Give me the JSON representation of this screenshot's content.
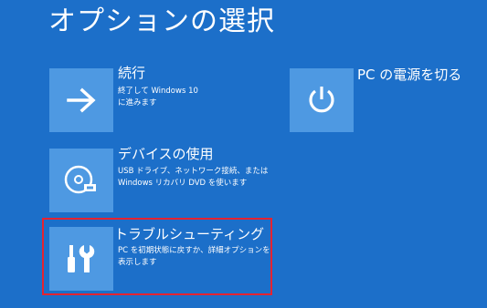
{
  "page": {
    "title": "オプションの選択",
    "accent_color": "#1c6fc9",
    "tile_color": "#4e99e2",
    "highlight_color": "#e52330"
  },
  "options": [
    {
      "id": "continue",
      "title": "続行",
      "desc_line1": "終了して Windows 10",
      "desc_line2": "に進みます",
      "icon": "arrow-right-icon"
    },
    {
      "id": "use-device",
      "title": "デバイスの使用",
      "desc_line1": "USB ドライブ、ネットワーク接続、または",
      "desc_line2": "Windows リカバリ DVD を使います",
      "icon": "disc-drive-icon"
    },
    {
      "id": "troubleshoot",
      "title": "トラブルシューティング",
      "desc_line1": "PC を初期状態に戻すか、詳細オプションを",
      "desc_line2": "表示します",
      "icon": "tools-icon",
      "highlighted": true
    },
    {
      "id": "power-off",
      "title": "PC の電源を切る",
      "icon": "power-icon"
    }
  ]
}
